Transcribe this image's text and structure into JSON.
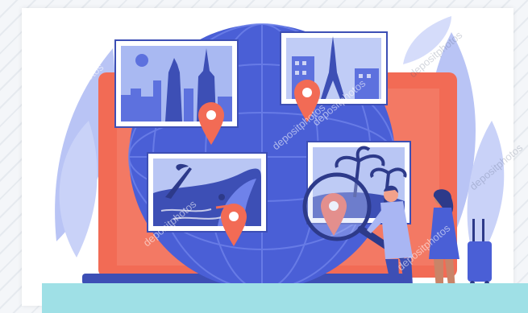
{
  "watermark": {
    "text": "depositphotos"
  },
  "colors": {
    "globe": "#4a5fd6",
    "laptop": "#f26b55",
    "laptop_base": "#3d4fb5",
    "leaf": "#a9b6f3",
    "card_bg": "#ffffff",
    "pin": "#f26b55",
    "accent_bar": "#9fe0e6"
  },
  "photos": [
    {
      "name": "new-york-skyline"
    },
    {
      "name": "paris-eiffel-tower"
    },
    {
      "name": "surfing-beach"
    },
    {
      "name": "tropical-palms"
    }
  ]
}
